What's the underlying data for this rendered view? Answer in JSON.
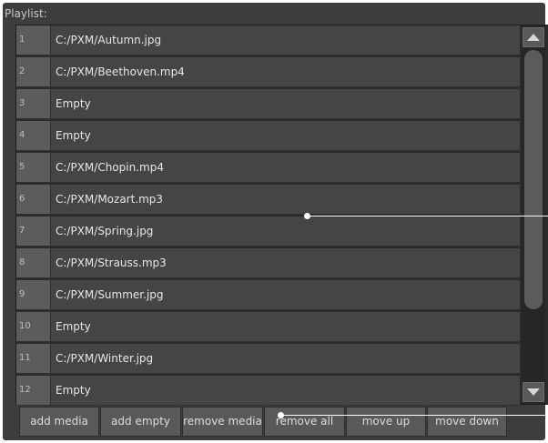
{
  "panel": {
    "title": "Playlist:"
  },
  "playlist": {
    "rows": [
      {
        "index": "1",
        "label": "C:/PXM/Autumn.jpg"
      },
      {
        "index": "2",
        "label": "C:/PXM/Beethoven.mp4"
      },
      {
        "index": "3",
        "label": "Empty"
      },
      {
        "index": "4",
        "label": "Empty"
      },
      {
        "index": "5",
        "label": "C:/PXM/Chopin.mp4"
      },
      {
        "index": "6",
        "label": "C:/PXM/Mozart.mp3"
      },
      {
        "index": "7",
        "label": "C:/PXM/Spring.jpg"
      },
      {
        "index": "8",
        "label": "C:/PXM/Strauss.mp3"
      },
      {
        "index": "9",
        "label": "C:/PXM/Summer.jpg"
      },
      {
        "index": "10",
        "label": "Empty"
      },
      {
        "index": "11",
        "label": "C:/PXM/Winter.jpg"
      },
      {
        "index": "12",
        "label": "Empty"
      }
    ]
  },
  "scrollbar": {
    "up_icon": "triangle-up-icon",
    "down_icon": "triangle-down-icon"
  },
  "buttons": {
    "add_media": "add media",
    "add_empty": "add empty",
    "remove_media": "remove media",
    "remove_all": "remove all",
    "move_up": "move up",
    "move_down": "move down"
  },
  "colors": {
    "panel_bg": "#3d3d3d",
    "row_bg": "#454545",
    "index_bg": "#5c5c5c",
    "text": "#e6e6e6",
    "annotation": "#ffffff"
  }
}
